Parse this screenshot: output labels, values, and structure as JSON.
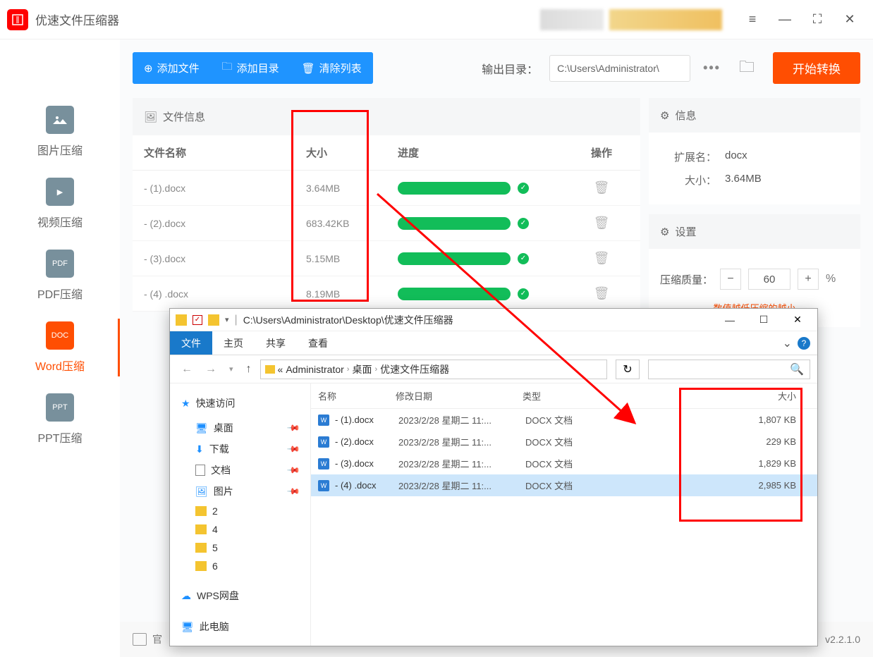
{
  "app": {
    "title": "优速文件压缩器",
    "version": "v2.2.1.0"
  },
  "titlebar_icons": {
    "menu": "≡",
    "min": "—",
    "full": "⛶",
    "close": "✕"
  },
  "sidebar": {
    "items": [
      {
        "icon": "",
        "label": "图片压缩"
      },
      {
        "icon": "▶",
        "label": "视频压缩"
      },
      {
        "icon": "PDF",
        "label": "PDF压缩"
      },
      {
        "icon": "DOC",
        "label": "Word压缩"
      },
      {
        "icon": "PPT",
        "label": "PPT压缩"
      }
    ]
  },
  "toolbar": {
    "add_file": "添加文件",
    "add_dir": "添加目录",
    "clear": "清除列表",
    "outdir_label": "输出目录：",
    "outdir_value": "C:\\Users\\Administrator\\",
    "start": "开始转换"
  },
  "columns": {
    "file_info": "文件信息",
    "name": "文件名称",
    "size": "大小",
    "progress": "进度",
    "op": "操作"
  },
  "files": [
    {
      "name": "- (1).docx",
      "size": "3.64MB"
    },
    {
      "name": "- (2).docx",
      "size": "683.42KB"
    },
    {
      "name": "- (3).docx",
      "size": "5.15MB"
    },
    {
      "name": "- (4) .docx",
      "size": "8.19MB"
    }
  ],
  "info_panel": {
    "title": "信息",
    "ext_k": "扩展名：",
    "ext_v": "docx",
    "size_k": "大小：",
    "size_v": "3.64MB"
  },
  "settings_panel": {
    "title": "设置",
    "quality_label": "压缩质量：",
    "quality_value": "60",
    "pct": "%",
    "hint": "数值越低压缩的越小"
  },
  "explorer": {
    "path_text": "C:\\Users\\Administrator\\Desktop\\优速文件压缩器",
    "tabs": {
      "file": "文件",
      "home": "主页",
      "share": "共享",
      "view": "查看"
    },
    "crumbs": [
      "Administrator",
      "桌面",
      "优速文件压缩器"
    ],
    "crumb_prefix": "«",
    "side": {
      "quick": "快速访问",
      "desktop": "桌面",
      "downloads": "下载",
      "documents": "文档",
      "pictures": "图片",
      "f2": "2",
      "f4": "4",
      "f5": "5",
      "f6": "6",
      "wps": "WPS网盘",
      "thispc": "此电脑"
    },
    "cols": {
      "name": "名称",
      "date": "修改日期",
      "type": "类型",
      "size": "大小"
    },
    "rows": [
      {
        "name": "- (1).docx",
        "date": "2023/2/28 星期二 11:...",
        "type": "DOCX 文档",
        "size": "1,807 KB"
      },
      {
        "name": "- (2).docx",
        "date": "2023/2/28 星期二 11:...",
        "type": "DOCX 文档",
        "size": "229 KB"
      },
      {
        "name": "- (3).docx",
        "date": "2023/2/28 星期二 11:...",
        "type": "DOCX 文档",
        "size": "1,829 KB"
      },
      {
        "name": "- (4) .docx",
        "date": "2023/2/28 星期二 11:...",
        "type": "DOCX 文档",
        "size": "2,985 KB"
      }
    ]
  },
  "footer": {
    "label": "官"
  }
}
